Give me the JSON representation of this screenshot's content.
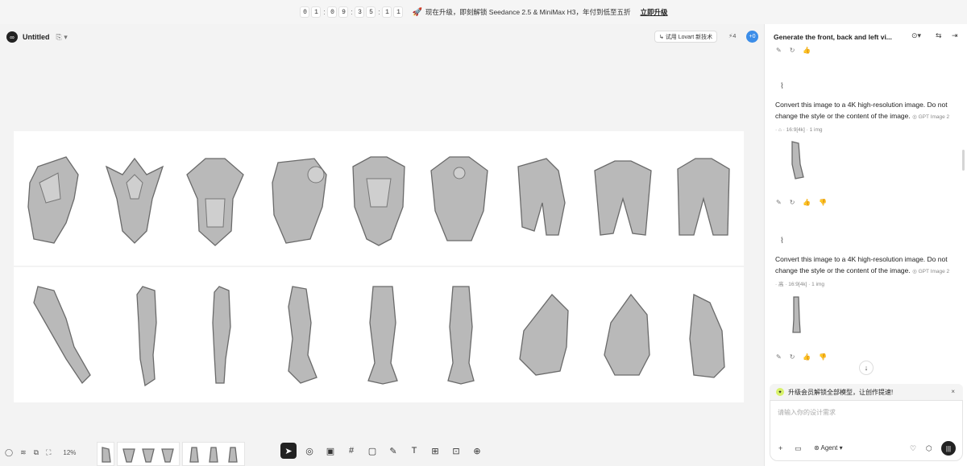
{
  "banner": {
    "countdown": [
      "0",
      "1",
      ":",
      "0",
      "9",
      ":",
      "3",
      "5",
      ":",
      "1",
      "1"
    ],
    "text": "现在升级，即刻解锁 Seedance 2.5 & MiniMax H3，年付到低至五折",
    "link": "立即升级"
  },
  "header": {
    "title": "Untitled",
    "try_button": "↳ 试用 Lovart 新技术",
    "credits": "⚡4",
    "avatar_text": "+0"
  },
  "toolbar": {
    "zoom": "12%",
    "tools": [
      "select",
      "pin",
      "image-edit",
      "frame",
      "rectangle",
      "pen",
      "text",
      "image-gen",
      "video-gen",
      "upscale"
    ]
  },
  "panel": {
    "title": "Generate the front, back and left vi...",
    "messages": [
      {
        "text": "Convert this image to a 4K high-resolution image. Do not change the style or the content of the image.",
        "meta": "◎ GPT Image 2 · ⌂ · 16:9[4k] · 1 img"
      },
      {
        "text": "Convert this image to a 4K high-resolution image. Do not change the style or the content of the image.",
        "meta": "◎ GPT Image 2 · 高 · 16:9[4k] · 1 img"
      }
    ],
    "promo": "升级会员解锁全部模型，让创作提速!",
    "input_placeholder": "请输入你的设计需求",
    "agent_label": "Agent"
  },
  "colors": {
    "accent": "#3b8de8",
    "promo_star": "#d8f26b",
    "dark": "#222222"
  }
}
